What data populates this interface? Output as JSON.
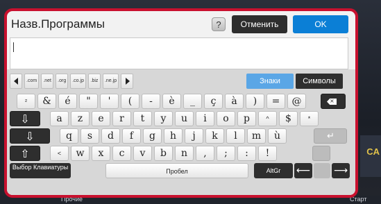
{
  "header": {
    "title": "Назв.Программы",
    "help_label": "?",
    "cancel_label": "Отменить",
    "ok_label": "OK"
  },
  "input": {
    "value": ""
  },
  "domain_keys": [
    ".com",
    ".net",
    ".org",
    ".co.jp",
    ".biz",
    ".ne.jp"
  ],
  "mode_tabs": {
    "active": "Знаки",
    "other": "Символы"
  },
  "rows": {
    "row1": [
      "²",
      "&",
      "é",
      "\"",
      "'",
      "(",
      "-",
      "è",
      "_",
      "ç",
      "à",
      ")",
      "=",
      "@"
    ],
    "row2": [
      "a",
      "z",
      "e",
      "r",
      "t",
      "y",
      "u",
      "i",
      "o",
      "p",
      "^",
      "$",
      "*"
    ],
    "row3": [
      "q",
      "s",
      "d",
      "f",
      "g",
      "h",
      "j",
      "k",
      "l",
      "m",
      "ù"
    ],
    "row4": [
      "<",
      "w",
      "x",
      "c",
      "v",
      "b",
      "n",
      ",",
      ";",
      ":",
      "!"
    ]
  },
  "bottom": {
    "layout_label": "Выбор Клавиатуры",
    "space_label": "Пробел",
    "altgr_label": "AltGr"
  },
  "background": {
    "bottom_labels": [
      "Прочие",
      "Старт"
    ],
    "right_fragment": "CA"
  }
}
